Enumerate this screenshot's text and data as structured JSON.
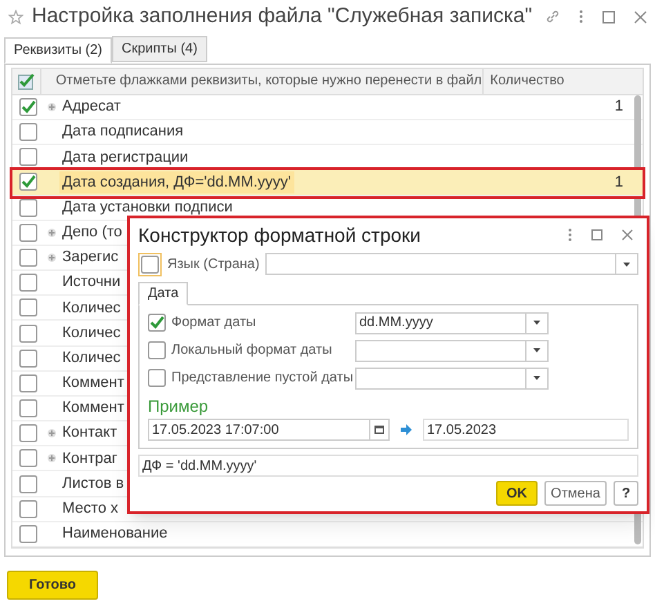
{
  "window": {
    "title": "Настройка заполнения файла \"Служебная записка\""
  },
  "tabs": [
    {
      "label": "Реквизиты (2)",
      "selected": true
    },
    {
      "label": "Скрипты (4)",
      "selected": false
    }
  ],
  "table": {
    "columns": [
      "Отметьте флажками реквизиты, которые нужно перенести в файл",
      "Количество"
    ],
    "rows": [
      {
        "checked": true,
        "expandable": true,
        "name": "Адресат",
        "count": "1",
        "selected": false
      },
      {
        "checked": false,
        "expandable": false,
        "name": "Дата подписания",
        "selected": false
      },
      {
        "checked": false,
        "expandable": false,
        "name": "Дата регистрации",
        "selected": false
      },
      {
        "checked": true,
        "expandable": false,
        "name": "Дата создания, ДФ='dd.MM.yyyy'",
        "count": "1",
        "selected": true
      },
      {
        "checked": false,
        "expandable": false,
        "name": "Дата установки подписи",
        "selected": false
      },
      {
        "checked": false,
        "expandable": true,
        "name": "Депо (то",
        "selected": false
      },
      {
        "checked": false,
        "expandable": true,
        "name": "Зарегис",
        "selected": false
      },
      {
        "checked": false,
        "expandable": false,
        "name": "Источни",
        "selected": false
      },
      {
        "checked": false,
        "expandable": false,
        "name": "Количес",
        "selected": false
      },
      {
        "checked": false,
        "expandable": false,
        "name": "Количес",
        "selected": false
      },
      {
        "checked": false,
        "expandable": false,
        "name": "Количес",
        "selected": false
      },
      {
        "checked": false,
        "expandable": false,
        "name": "Коммент",
        "selected": false
      },
      {
        "checked": false,
        "expandable": false,
        "name": "Коммент",
        "selected": false
      },
      {
        "checked": false,
        "expandable": true,
        "name": "Контакт",
        "selected": false
      },
      {
        "checked": false,
        "expandable": true,
        "name": "Контраг",
        "selected": false
      },
      {
        "checked": false,
        "expandable": false,
        "name": "Листов в",
        "selected": false
      },
      {
        "checked": false,
        "expandable": false,
        "name": "Место х",
        "selected": false
      },
      {
        "checked": false,
        "expandable": false,
        "name": "Наименование",
        "selected": false
      }
    ]
  },
  "done_button": "Готово",
  "dialog": {
    "title": "Конструктор форматной строки",
    "language": {
      "label": "Язык (Страна)",
      "checked": false
    },
    "tabs": [
      {
        "label": "Дата",
        "selected": true
      }
    ],
    "options": [
      {
        "label": "Формат даты",
        "checked": true,
        "value": "dd.MM.yyyy"
      },
      {
        "label": "Локальный формат даты",
        "checked": false
      },
      {
        "label": "Представление пустой даты",
        "checked": false
      }
    ],
    "example_title": "Пример",
    "example_input": "17.05.2023 17:07:00",
    "example_output": "17.05.2023",
    "result": "ДФ = 'dd.MM.yyyy'",
    "buttons": [
      {
        "kind": "primary",
        "label": "OK"
      },
      {
        "kind": "normal",
        "label": "Отмена"
      },
      {
        "kind": "help",
        "label": "?"
      }
    ]
  }
}
